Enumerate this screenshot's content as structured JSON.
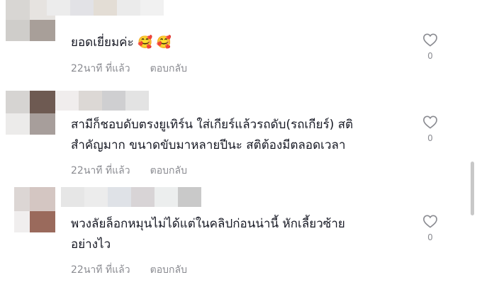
{
  "comments": [
    {
      "text": "ยอดเยี่ยมค่ะ",
      "emojis": "🥰 🥰",
      "time": "22นาที ที่แล้ว",
      "reply_label": "ตอบกลับ",
      "likes": "0",
      "icon": "heart-outline-icon"
    },
    {
      "text_line1": "สามีก็ชอบดับตรงยูเทิร์น ใส่เกียร์แล้วรถดับ(รถเกียร์) สติ",
      "text_line2": "สำคัญมาก ขนาดขับมาหลายปีนะ สติต้องมีตลอดเวลา",
      "time": "22นาที ที่แล้ว",
      "reply_label": "ตอบกลับ",
      "likes": "0",
      "icon": "heart-outline-icon"
    },
    {
      "text_line1": "พวงลัยล็อกหมุนไม่ได้แต่ในคลิปก่อนน่านี้ หักเลี้ยวซ้าย",
      "text_line2": "อย่างไว",
      "time": "22นาที ที่แล้ว",
      "reply_label": "ตอบกลับ",
      "likes": "0",
      "icon": "heart-outline-icon"
    }
  ],
  "colors": {
    "text": "#161823",
    "meta": "#8a8b91",
    "icon": "#8a8b91"
  }
}
